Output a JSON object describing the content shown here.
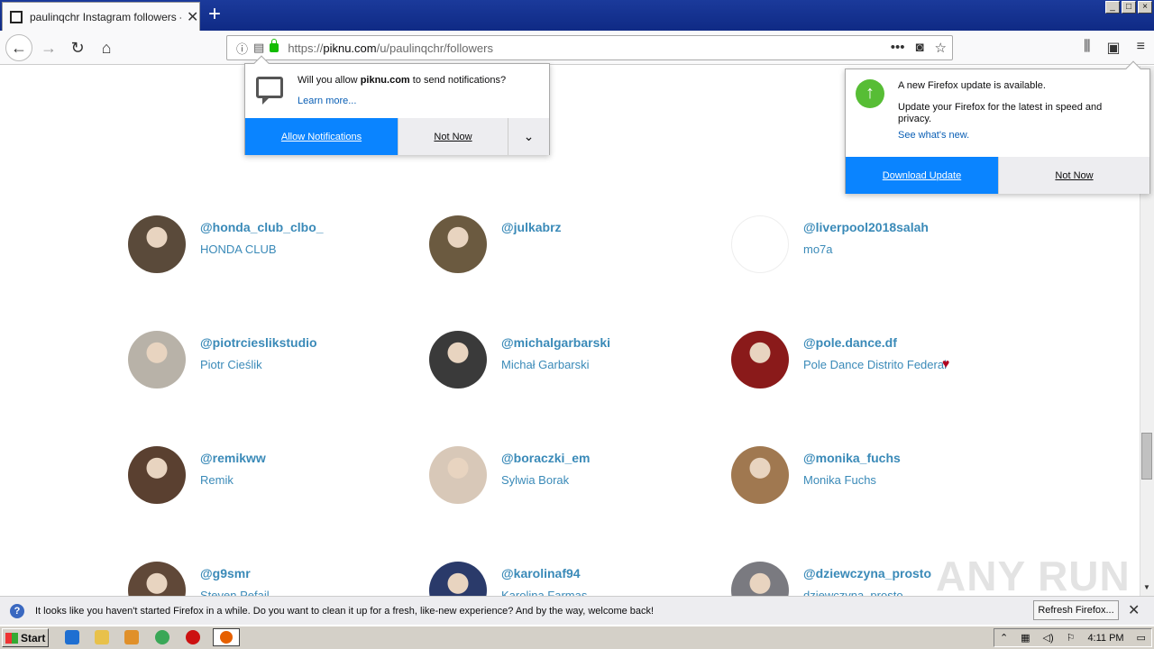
{
  "window": {
    "tab_title": "paulinqchr Instagram followers - Pi",
    "controls": [
      "_",
      "□",
      "×"
    ]
  },
  "navbar": {
    "url_host_prefix": "https://",
    "url_host": "piknu.com",
    "url_path": "/u/paulinqchr/followers"
  },
  "notification_popup": {
    "message_prefix": "Will you allow ",
    "message_host": "piknu.com",
    "message_suffix": " to send notifications?",
    "learn_more": "Learn more...",
    "allow_label": "Allow Notifications",
    "not_now_label": "Not Now"
  },
  "update_popup": {
    "heading": "A new Firefox update is available.",
    "body": "Update your Firefox for the latest in speed and privacy.",
    "link": "See what's new.",
    "download_label": "Download Update",
    "not_now_label": "Not Now"
  },
  "followers": [
    {
      "handle": "@honda_club_clbo_",
      "name": "HONDA CLUB",
      "avatar_color": "#5a4a3a"
    },
    {
      "handle": "@julkabrz",
      "name": "",
      "avatar_color": "#6b5a40"
    },
    {
      "handle": "@liverpool2018salah",
      "name": "mo7a",
      "avatar_color": "#ffffff"
    },
    {
      "handle": "@piotrcieslikstudio",
      "name": "Piotr Cieślik",
      "avatar_color": "#b8b2a8"
    },
    {
      "handle": "@michalgarbarski",
      "name": "Michał Garbarski",
      "avatar_color": "#3a3a3a"
    },
    {
      "handle": "@pole.dance.df",
      "name": "Pole Dance Distrito Federal",
      "avatar_color": "#8a1a1a"
    },
    {
      "handle": "@remikww",
      "name": "Remik",
      "avatar_color": "#5a4030"
    },
    {
      "handle": "@boraczki_em",
      "name": "Sylwia Borak",
      "avatar_color": "#d8c8b8"
    },
    {
      "handle": "@monika_fuchs",
      "name": "Monika Fuchs",
      "avatar_color": "#a07850"
    },
    {
      "handle": "@g9smr",
      "name": "Steven Pefail",
      "avatar_color": "#604838"
    },
    {
      "handle": "@karolinaf94",
      "name": "Karolina Farmas",
      "avatar_color": "#2a3a6a"
    },
    {
      "handle": "@dziewczyna_prosto",
      "name": "dziewczyna_prosto",
      "avatar_color": "#7a7a80"
    }
  ],
  "infobar": {
    "message": "It looks like you haven't started Firefox in a while. Do you want to clean it up for a fresh, like-new experience? And by the way, welcome back!",
    "refresh_label": "Refresh Firefox..."
  },
  "taskbar": {
    "start_label": "Start",
    "clock": "4:11 PM"
  },
  "watermark": "ANY RUN"
}
